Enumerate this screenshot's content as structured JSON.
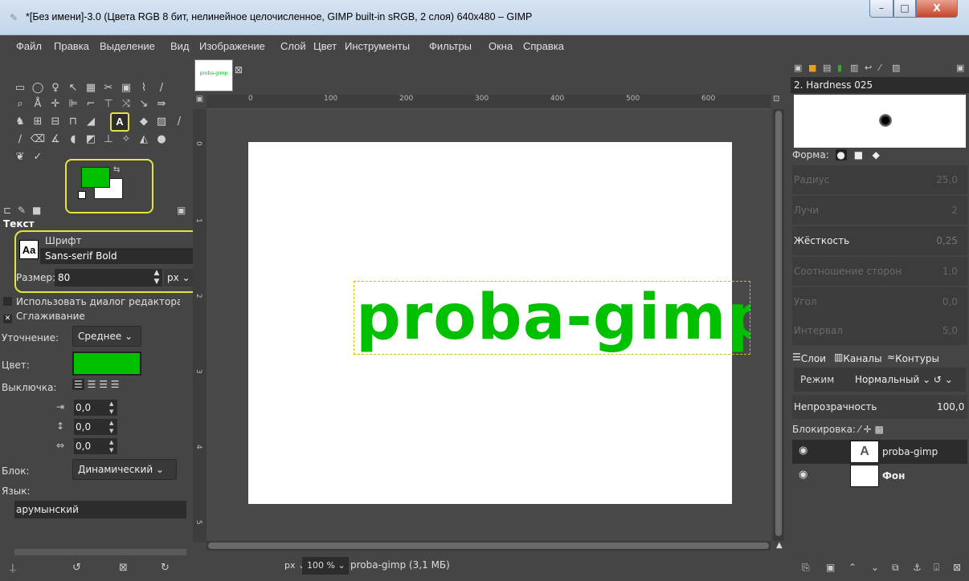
{
  "window": {
    "title": "*[Без имени]-3.0 (Цвета RGB 8 бит, нелинейное целочисленное, GIMP built-in sRGB, 2 слоя) 640x480 – GIMP",
    "minimize": "–",
    "maximize": "□",
    "close": "X"
  },
  "menu": [
    "Файл",
    "Правка",
    "Выделение",
    "Вид",
    "Изображение",
    "Слой",
    "Цвет",
    "Инструменты",
    "Фильтры",
    "Окна",
    "Справка"
  ],
  "colors": {
    "foreground": "#00c000",
    "background": "#ffffff",
    "highlight": "#e4e43a"
  },
  "tool_options": {
    "title": "Текст",
    "font_label": "Шрифт",
    "font_icon": "Aa",
    "font_value": "Sans-serif Bold",
    "size_label": "Размер:",
    "size_value": "80",
    "size_unit": "px",
    "use_editor": "Использовать диалог редактора",
    "antialias": "Сглаживание",
    "hinting_label": "Уточнение:",
    "hinting_value": "Среднее",
    "color_label": "Цвет:",
    "justify_label": "Выключка:",
    "indent": "0,0",
    "line_spacing": "0,0",
    "letter_spacing": "0,0",
    "box_label": "Блок:",
    "box_value": "Динамический",
    "language_label": "Язык:",
    "language_value": "арумынский"
  },
  "tool_selected_label": "A",
  "canvas": {
    "tab_thumb_text": "proba-gimp",
    "text_content": "proba-gimp",
    "ruler_h": [
      "0",
      "100",
      "200",
      "300",
      "400",
      "500",
      "600"
    ],
    "ruler_v": [
      "0",
      "1",
      "2",
      "3",
      "4",
      "5"
    ]
  },
  "status": {
    "unit": "px",
    "zoom": "100 %",
    "info": "proba-gimp (3,1 МБ)"
  },
  "brushes": {
    "selected": "2. Hardness 025",
    "shape_label": "Форма:",
    "params": [
      {
        "label": "Радиус",
        "value": "25,0"
      },
      {
        "label": "Лучи",
        "value": "2"
      },
      {
        "label": "Жёсткость",
        "value": "0,25"
      },
      {
        "label": "Соотношение сторон",
        "value": "1,0"
      },
      {
        "label": "Угол",
        "value": "0,0"
      },
      {
        "label": "Интервал",
        "value": "5,0"
      }
    ]
  },
  "layers": {
    "tab_layers": "Слои",
    "tab_channels": "Каналы",
    "tab_paths": "Контуры",
    "mode_label": "Режим",
    "mode_value": "Нормальный",
    "opacity_label": "Непрозрачность",
    "opacity_value": "100,0",
    "lock_label": "Блокировка:",
    "items": [
      {
        "name": "proba-gimp",
        "thumb": "A",
        "bold": false
      },
      {
        "name": "Фон",
        "thumb": "",
        "bold": true
      }
    ]
  }
}
